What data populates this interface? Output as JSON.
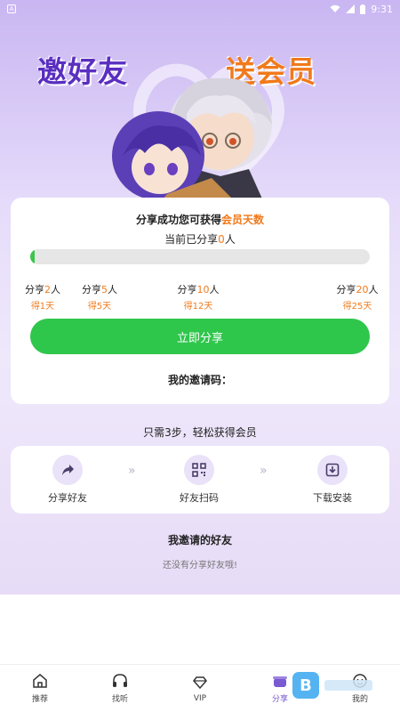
{
  "status_bar": {
    "app_icon_text": "A",
    "time": "9:31"
  },
  "hero": {
    "title_left": "邀好友",
    "title_right": "送会员"
  },
  "reward_card": {
    "headline_prefix": "分享成功您可获得",
    "headline_highlight": "会员天数",
    "shared_prefix": "当前已分享",
    "shared_count": "0",
    "shared_suffix": "人",
    "progress_fraction": 0,
    "milestones": [
      {
        "prefix": "分亨",
        "num": "2",
        "suffix": "人",
        "reward": "得1天"
      },
      {
        "prefix": "分亨",
        "num": "5",
        "suffix": "人",
        "reward": "得5天"
      },
      {
        "prefix": "分亨",
        "num": "10",
        "suffix": "人",
        "reward": "得12天"
      },
      {
        "prefix": "分亨",
        "num": "20",
        "suffix": "人",
        "reward": "得25天"
      }
    ],
    "share_button_label": "立即分享",
    "invite_code_label": "我的邀请码："
  },
  "steps": {
    "title": "只需3步，轻松获得会员",
    "items": [
      {
        "label": "分享好友",
        "icon": "share-arrow-icon"
      },
      {
        "label": "好友扫码",
        "icon": "qr-code-icon"
      },
      {
        "label": "下载安装",
        "icon": "download-icon"
      }
    ],
    "arrow": "»"
  },
  "friends": {
    "title": "我邀请的好友",
    "empty_text": "还没有分享好友哦!"
  },
  "tab_bar": {
    "items": [
      {
        "label": "推荐",
        "icon": "home-icon"
      },
      {
        "label": "找听",
        "icon": "headphones-icon"
      },
      {
        "label": "VIP",
        "icon": "diamond-icon"
      },
      {
        "label": "分享",
        "icon": "gift-pot-icon"
      },
      {
        "label": "我的",
        "icon": "profile-icon"
      }
    ],
    "active_index": 3
  },
  "watermark": {
    "badge": "B"
  },
  "colors": {
    "accent_orange": "#f07a1c",
    "green": "#2fc64c",
    "purple": "#5a2ec0"
  }
}
